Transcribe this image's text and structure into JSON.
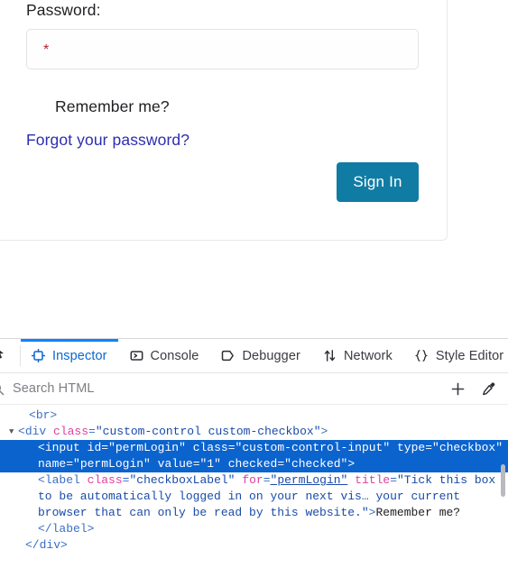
{
  "page": {
    "form": {
      "password_label": "Password:",
      "password_value": "",
      "password_required_marker": "*",
      "remember_me_label": "Remember me?",
      "forgot_password_link": "Forgot your password?",
      "signin_button": "Sign In"
    },
    "colors": {
      "signin_button_bg": "#107ca4",
      "link": "#2d2db0",
      "required_marker": "#b22234",
      "card_border": "#e8e8ea"
    }
  },
  "devtools": {
    "picker_icon": "element-picker-icon",
    "tabs": [
      {
        "label": "Inspector",
        "icon": "inspector-icon",
        "active": true
      },
      {
        "label": "Console",
        "icon": "console-icon",
        "active": false
      },
      {
        "label": "Debugger",
        "icon": "debugger-icon",
        "active": false
      },
      {
        "label": "Network",
        "icon": "network-icon",
        "active": false
      },
      {
        "label": "Style Editor",
        "icon": "style-editor-icon",
        "active": false
      }
    ],
    "search": {
      "placeholder": "Search HTML",
      "icon": "search-icon",
      "value": ""
    },
    "actions": [
      {
        "name": "add-new-node-button",
        "icon": "plus-icon"
      },
      {
        "name": "color-picker-button",
        "icon": "eyedropper-icon"
      }
    ],
    "markup": {
      "lines": [
        {
          "id": "l1",
          "selected": false,
          "twisty": "",
          "indent": 32,
          "tokens": [
            {
              "t": "punct",
              "s": "<"
            },
            {
              "t": "tag",
              "s": "br"
            },
            {
              "t": "punct",
              "s": ">"
            }
          ]
        },
        {
          "id": "l2",
          "selected": false,
          "twisty": "▼",
          "indent": 20,
          "tokens": [
            {
              "t": "punct",
              "s": "<"
            },
            {
              "t": "tag",
              "s": "div"
            },
            {
              "t": "txt",
              "s": " "
            },
            {
              "t": "attr",
              "s": "class"
            },
            {
              "t": "punct",
              "s": "="
            },
            {
              "t": "val",
              "s": "\"custom-control custom-checkbox\""
            },
            {
              "t": "punct",
              "s": ">"
            }
          ]
        },
        {
          "id": "l3",
          "selected": true,
          "twisty": "",
          "indent": 42,
          "tokens": [
            {
              "t": "punct",
              "s": "<"
            },
            {
              "t": "tag",
              "s": "input"
            },
            {
              "t": "txt",
              "s": " "
            },
            {
              "t": "attr",
              "s": "id"
            },
            {
              "t": "punct",
              "s": "="
            },
            {
              "t": "val",
              "s": "\"permLogin\""
            },
            {
              "t": "txt",
              "s": " "
            },
            {
              "t": "attr",
              "s": "class"
            },
            {
              "t": "punct",
              "s": "="
            },
            {
              "t": "val",
              "s": "\"custom-control-input\""
            },
            {
              "t": "txt",
              "s": " "
            },
            {
              "t": "attr",
              "s": "type"
            },
            {
              "t": "punct",
              "s": "="
            },
            {
              "t": "val",
              "s": "\"checkbox\""
            },
            {
              "t": "txt",
              "s": " "
            },
            {
              "t": "attr",
              "s": "name"
            },
            {
              "t": "punct",
              "s": "="
            },
            {
              "t": "val",
              "s": "\"permLogin\""
            },
            {
              "t": "txt",
              "s": " "
            },
            {
              "t": "attr",
              "s": "value"
            },
            {
              "t": "punct",
              "s": "="
            },
            {
              "t": "val",
              "s": "\"1\""
            },
            {
              "t": "txt",
              "s": " "
            },
            {
              "t": "attr",
              "s": "checked"
            },
            {
              "t": "punct",
              "s": "="
            },
            {
              "t": "val",
              "s": "\"checked\""
            },
            {
              "t": "punct",
              "s": ">"
            }
          ]
        },
        {
          "id": "l4",
          "selected": false,
          "twisty": "",
          "indent": 42,
          "tokens": [
            {
              "t": "punct",
              "s": "<"
            },
            {
              "t": "tag",
              "s": "label"
            },
            {
              "t": "txt",
              "s": " "
            },
            {
              "t": "attr",
              "s": "class"
            },
            {
              "t": "punct",
              "s": "="
            },
            {
              "t": "val",
              "s": "\"checkboxLabel\""
            },
            {
              "t": "txt",
              "s": " "
            },
            {
              "t": "attr",
              "s": "for"
            },
            {
              "t": "punct",
              "s": "="
            },
            {
              "t": "val link",
              "s": "\"permLogin\""
            },
            {
              "t": "txt",
              "s": " "
            },
            {
              "t": "attr",
              "s": "title"
            },
            {
              "t": "punct",
              "s": "="
            },
            {
              "t": "val",
              "s": "\"Tick this box to be automatically logged in on your next vis… your current browser that can only be read by this website.\""
            },
            {
              "t": "punct",
              "s": ">"
            },
            {
              "t": "txt",
              "s": "Remember me?"
            }
          ]
        },
        {
          "id": "l5",
          "selected": false,
          "twisty": "",
          "indent": 42,
          "tokens": [
            {
              "t": "punct",
              "s": "</"
            },
            {
              "t": "tag",
              "s": "label"
            },
            {
              "t": "punct",
              "s": ">"
            }
          ]
        },
        {
          "id": "l6",
          "selected": false,
          "twisty": "",
          "indent": 28,
          "tokens": [
            {
              "t": "punct",
              "s": "</"
            },
            {
              "t": "tag",
              "s": "div"
            },
            {
              "t": "punct",
              "s": ">"
            }
          ]
        }
      ]
    }
  }
}
